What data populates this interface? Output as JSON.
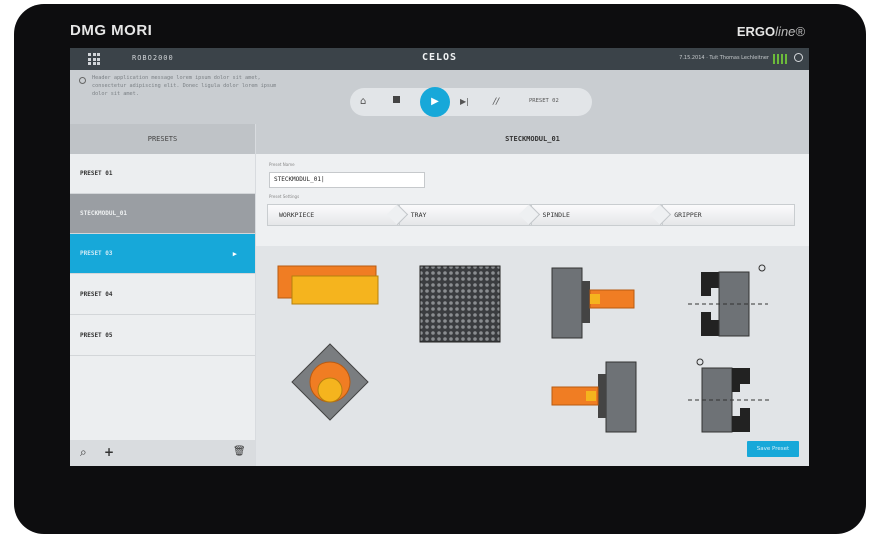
{
  "device": {
    "brand_left": "DMG MORI",
    "brand_right_main": "ERGO",
    "brand_right_italic": "line®"
  },
  "topbar": {
    "app_id": "ROBO2000",
    "title": "CELOS",
    "status_text": "7.15.2014 · Tuit Thomas Lechleitner"
  },
  "message": {
    "text": "Header application message lorem ipsum dolor sit amet, consectetur adipiscing elit. Donec ligula dolor lorem ipsum dolor sit amet."
  },
  "media": {
    "preset_label": "PRESET 02"
  },
  "presets": {
    "header": "PRESETS",
    "items": [
      "PRESET 01",
      "STECKMODUL_01",
      "PRESET 03",
      "PRESET 04",
      "PRESET 05"
    ]
  },
  "editor": {
    "title": "STECKMODUL_01",
    "name_label": "Preset Name",
    "name_value": "STECKMODUL_01|",
    "settings_label": "Preset Settings",
    "steps": [
      "WORKPIECE",
      "TRAY",
      "SPINDLE",
      "GRIPPER"
    ],
    "save_label": "Save Preset"
  },
  "colors": {
    "accent": "#17a8d9",
    "orange": "#f07d23",
    "yellow": "#f5b41e",
    "signal": "#6dbb3a"
  },
  "icons": [
    "apps-icon",
    "power-icon",
    "home-icon",
    "stop-icon",
    "play-icon",
    "skip-icon",
    "reset-icon",
    "search-icon",
    "add-icon",
    "trash-icon"
  ]
}
